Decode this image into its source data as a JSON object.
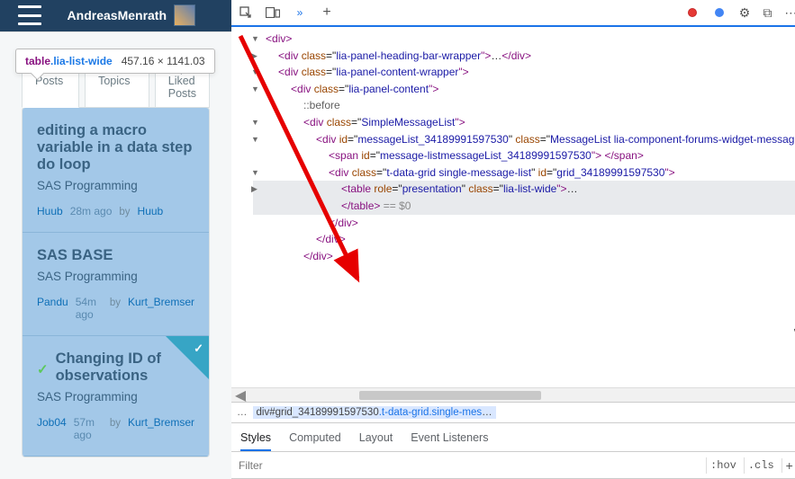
{
  "header": {
    "user": "AndreasMenrath"
  },
  "tooltip": {
    "tag": "table",
    "cls": ".lia-list-wide",
    "dims": "457.16 × 1141.03"
  },
  "tabs": {
    "latest": "Latest Posts",
    "mid": "Newest Topics",
    "liked": "Top Liked Posts"
  },
  "posts": [
    {
      "title": "editing a macro variable in a data step do loop",
      "category": "SAS Programming",
      "author": "Huub",
      "time": "28m ago",
      "byLabel": "by",
      "by": "Huub",
      "solved": false
    },
    {
      "title": "SAS BASE",
      "category": "SAS Programming",
      "author": "Pandu",
      "time": "54m ago",
      "byLabel": "by",
      "by": "Kurt_Bremser",
      "solved": false
    },
    {
      "title": "Changing ID of observations",
      "category": "SAS Programming",
      "author": "Job04",
      "time": "57m ago",
      "byLabel": "by",
      "by": "Kurt_Bremser",
      "solved": true
    }
  ],
  "dom": {
    "l1": "<div>",
    "l2a": "<div ",
    "l2b": "class",
    "l2c": "=\"",
    "l2d": "lia-panel-heading-bar-wrapper",
    "l2e": "\">",
    "l2f": "…",
    "l2g": "</div>",
    "l3a": "<div ",
    "l3b": "lia-panel-content-wrapper",
    "l3c": "\">",
    "l4a": "<div ",
    "l4b": "lia-panel-content",
    "l4c": "\">",
    "pseudo": "::before",
    "l5a": "<div ",
    "l5b": "SimpleMessageList",
    "l5c": "\">",
    "l6a": "<div ",
    "l6id": "id",
    "l6idval": "messageList_34189991597530",
    "l6b": "MessageList lia-component-forums-widget-message-list",
    "l6c": "\">",
    "l7a": "<span ",
    "l7id": "message-listmessageList_34189991597530",
    "l7c": "\"> ",
    "l7d": "</span>",
    "l8a": "<div ",
    "l8b": "t-data-grid single-message-list",
    "l8idval": "grid_34189991597530",
    "l8c": "\">",
    "l9a": "<table ",
    "l9role": "role",
    "l9roleval": "presentation",
    "l9b": "lia-list-wide",
    "l9c": "\">",
    "l9d": "…",
    "l9e": "</table>",
    "l9eq": " == $0",
    "l10": "</div>",
    "l11": "</div>"
  },
  "breadcrumb": {
    "el": "…",
    "sel1": "div#grid_34189991597530",
    "sel2": ".t-data-grid.single-mes",
    "sel3": "…"
  },
  "stylesTabs": {
    "styles": "Styles",
    "computed": "Computed",
    "layout": "Layout",
    "ev": "Event Listeners"
  },
  "filter": {
    "placeholder": "Filter",
    "hov": ":hov",
    "cls": ".cls"
  },
  "chevrons": "»"
}
